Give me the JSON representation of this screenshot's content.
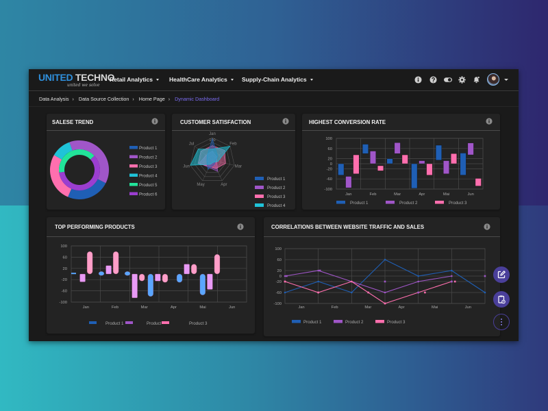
{
  "brand": {
    "word1": "UNITED",
    "word2": "TECHNO",
    "tagline": "united we solve"
  },
  "nav": [
    {
      "label": "Retail Analytics"
    },
    {
      "label": "HealthCare Analytics"
    },
    {
      "label": "Supply-Chain Analytics"
    }
  ],
  "toolbar_icons": [
    "info-icon",
    "help-icon",
    "toggle-icon",
    "gear-icon",
    "bell-icon"
  ],
  "breadcrumb": [
    "Data Analysis",
    "Data Source Collection",
    "Home Page",
    "Dynamic Dashboard"
  ],
  "colors": {
    "product1": "#1f5fb5",
    "product2": "#a056c8",
    "product3": "#ff6fae",
    "product4": "#1fc3d8",
    "product5": "#22e39a",
    "product6": "#9b3ed0",
    "accent": "#7b6cf0",
    "fab": "#4a3f9a"
  },
  "cards": {
    "sales_trend": {
      "title": "SALESE TREND"
    },
    "customer_satisfaction": {
      "title": "CUSTOMER SATISFACTION"
    },
    "conversion": {
      "title": "HIGHEST CONVERSION RATE"
    },
    "top_products": {
      "title": "TOP PERFORMING PRODUCTS"
    },
    "correlations": {
      "title": "CORRELATIONS BETWEEN WEBSITE TRAFFIC AND SALES"
    }
  },
  "chart_data": [
    {
      "id": "sales_trend",
      "type": "pie",
      "title": "SALESE TREND",
      "legend": [
        "Product 1",
        "Product 2",
        "Product 3",
        "Product 4",
        "Product 5",
        "Product 6"
      ],
      "legend_position": "right",
      "rings": [
        {
          "name": "outer",
          "slices": [
            {
              "label": "Product 2",
              "value": 38
            },
            {
              "label": "Product 1",
              "value": 24
            },
            {
              "label": "Product 3",
              "value": 27
            },
            {
              "label": "Product 4",
              "value": 11
            }
          ]
        },
        {
          "name": "inner",
          "slices": [
            {
              "label": "Product 5",
              "value": 40
            },
            {
              "label": "Product 6",
              "value": 60
            }
          ]
        }
      ]
    },
    {
      "id": "customer_satisfaction",
      "type": "radar",
      "title": "CUSTOMER SATISFACTION",
      "axes": [
        "Jan",
        "Feb",
        "Mar",
        "Apr",
        "May",
        "Jun",
        "Jul"
      ],
      "max_label": "100",
      "range": [
        0,
        100
      ],
      "legend_position": "right",
      "series": [
        {
          "name": "Product 1",
          "values": [
            95,
            30,
            15,
            20,
            45,
            25,
            30
          ]
        },
        {
          "name": "Product 2",
          "values": [
            40,
            25,
            20,
            55,
            35,
            60,
            35
          ]
        },
        {
          "name": "Product 3",
          "values": [
            65,
            70,
            60,
            40,
            30,
            65,
            65
          ]
        },
        {
          "name": "Product 4",
          "values": [
            50,
            100,
            25,
            10,
            20,
            100,
            80
          ]
        }
      ]
    },
    {
      "id": "conversion",
      "type": "bar",
      "subtype": "floating",
      "title": "HIGHEST CONVERSION RATE",
      "categories": [
        "Jan",
        "Feb",
        "Mar",
        "Apr",
        "Mai",
        "Jun"
      ],
      "yticks": [
        "100",
        "60",
        "20",
        "0",
        "-20",
        "-60",
        "-100"
      ],
      "ylim": [
        -100,
        100
      ],
      "legend_position": "bottom",
      "series": [
        {
          "name": "Product 1",
          "ranges": [
            [
              -45,
              0
            ],
            [
              40,
              77
            ],
            [
              0,
              20
            ],
            [
              -97,
              0
            ],
            [
              14,
              73
            ],
            [
              -45,
              42
            ]
          ]
        },
        {
          "name": "Product 2",
          "ranges": [
            [
              -95,
              -50
            ],
            [
              0,
              50
            ],
            [
              40,
              83
            ],
            [
              0,
              12
            ],
            [
              -40,
              12
            ],
            [
              35,
              82
            ]
          ]
        },
        {
          "name": "Product 3",
          "ranges": [
            [
              -40,
              35
            ],
            [
              -28,
              -8
            ],
            [
              0,
              35
            ],
            [
              -45,
              0
            ],
            [
              0,
              40
            ],
            [
              -88,
              -58
            ]
          ]
        }
      ]
    },
    {
      "id": "top_products",
      "type": "bar",
      "subtype": "floating",
      "title": "TOP PERFORMING PRODUCTS",
      "categories": [
        "Jan",
        "Feb",
        "Mar",
        "Apr",
        "Mai",
        "Jun"
      ],
      "yticks": [
        "100",
        "60",
        "20",
        "-20",
        "-60",
        "-100"
      ],
      "ylim": [
        -100,
        100
      ],
      "legend_position": "bottom",
      "legend_labels": [
        "Product 1",
        "Product",
        "Product 3"
      ],
      "series": [
        {
          "name": "Product 1",
          "points": [
            [
              0.0,
              0,
              3
            ],
            [
              0.9,
              0,
              9
            ],
            [
              1.8,
              0,
              9
            ],
            [
              2.6,
              -80,
              0
            ],
            [
              3.6,
              -30,
              0
            ],
            [
              4.4,
              -75,
              0
            ]
          ]
        },
        {
          "name": "Product 2",
          "points": [
            [
              0.25,
              -28,
              0
            ],
            [
              1.15,
              0,
              30
            ],
            [
              2.05,
              -85,
              0
            ],
            [
              2.85,
              -25,
              0
            ],
            [
              3.85,
              0,
              35
            ],
            [
              4.65,
              -55,
              0
            ]
          ]
        },
        {
          "name": "Product 3",
          "points": [
            [
              0.5,
              0,
              80
            ],
            [
              1.4,
              0,
              80
            ],
            [
              2.3,
              -25,
              0
            ],
            [
              3.1,
              -30,
              0
            ],
            [
              4.1,
              0,
              35
            ],
            [
              4.9,
              0,
              70
            ]
          ]
        }
      ]
    },
    {
      "id": "correlations",
      "type": "line",
      "title": "CORRELATIONS BETWEEN WEBSITE TRAFFIC AND SALES",
      "categories": [
        "Jan",
        "Feb",
        "Mar",
        "Apr",
        "Mai",
        "Jun"
      ],
      "yticks": [
        "100",
        "60",
        "20",
        "0",
        "-20",
        "-60",
        "-100"
      ],
      "ylim": [
        -100,
        100
      ],
      "legend_position": "bottom",
      "series": [
        {
          "name": "Product 1",
          "x": [
            0,
            1,
            2,
            3,
            4,
            5,
            6
          ],
          "y": [
            -60,
            -20,
            -60,
            60,
            0,
            20,
            -60
          ]
        },
        {
          "name": "Product 2",
          "x": [
            0,
            1,
            2,
            3,
            4,
            5
          ],
          "y": [
            0,
            20,
            -20,
            -60,
            -20,
            0
          ]
        },
        {
          "name": "Product 3",
          "x": [
            0,
            1,
            2,
            3,
            4,
            5
          ],
          "y": [
            -20,
            -60,
            -20,
            -100,
            -60,
            -20
          ]
        }
      ],
      "scatter_points": [
        {
          "series": "Product 2",
          "x": [
            0.05,
            1.05,
            3.0,
            4.0,
            5.0,
            6.0
          ],
          "y": [
            0,
            20,
            -20,
            -60,
            -20,
            0
          ]
        },
        {
          "series": "Product 3",
          "x": [
            0.0,
            1.0,
            2.5,
            3.0,
            4.2,
            5.1
          ],
          "y": [
            -20,
            -60,
            -60,
            -100,
            -60,
            -20
          ]
        }
      ]
    }
  ],
  "fabs": [
    {
      "name": "edit-fab",
      "icon": "edit-icon"
    },
    {
      "name": "clipboard-fab",
      "icon": "clipboard-settings-icon"
    },
    {
      "name": "more-fab",
      "icon": "more-vertical-icon"
    }
  ]
}
